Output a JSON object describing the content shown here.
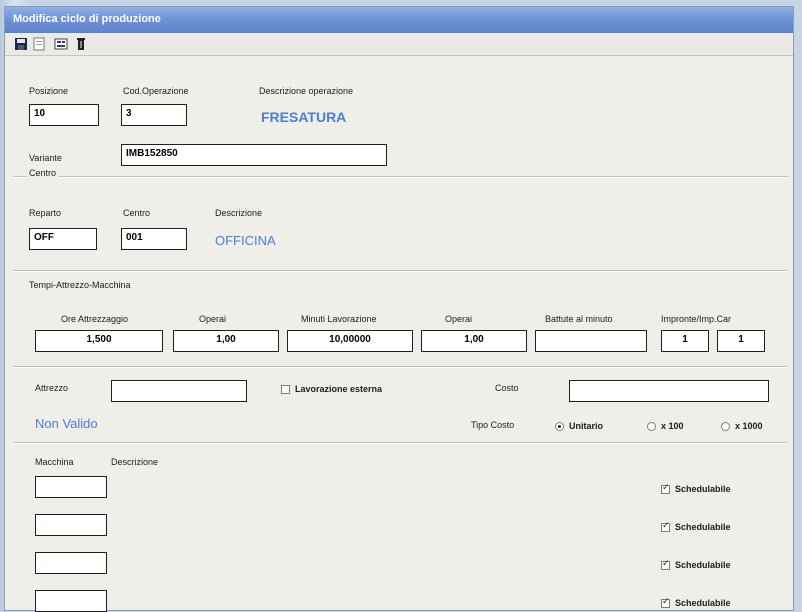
{
  "window": {
    "title": "Modifica ciclo di produzione"
  },
  "toolbar": [
    {
      "name": "save-icon"
    },
    {
      "name": "new-icon"
    },
    {
      "name": "properties-icon"
    },
    {
      "name": "delete-icon"
    }
  ],
  "operazione": {
    "posizione_label": "Posizione",
    "posizione_value": "10",
    "cod_operazione_label": "Cod.Operazione",
    "cod_operazione_value": "3",
    "descrizione_label": "Descrizione operazione",
    "descrizione_value": "FRESATURA",
    "variante_label": "Variante",
    "variante_value": "IMB152850"
  },
  "centro": {
    "group_title": "Centro",
    "reparto_label": "Reparto",
    "reparto_value": "OFF",
    "centro_label": "Centro",
    "centro_value": "001",
    "descrizione_label": "Descrizione",
    "descrizione_value": "OFFICINA"
  },
  "tempi": {
    "group_title": "Tempi-Attrezzo-Macchina",
    "ore_attrezzaggio_label": "Ore Attrezzaggio",
    "ore_attrezzaggio_value": "1,500",
    "operai1_label": "Operai",
    "operai1_value": "1,00",
    "minuti_label": "Minuti Lavorazione",
    "minuti_value": "10,00000",
    "operai2_label": "Operai",
    "operai2_value": "1,00",
    "battute_label": "Battute al minuto",
    "battute_value": "",
    "impronte_label": "Impronte/Imp.Car",
    "impronte_value1": "1",
    "impronte_value2": "1"
  },
  "attrezzo": {
    "attrezzo_label": "Attrezzo",
    "attrezzo_value": "",
    "status": "Non Valido",
    "lavorazione_esterna_label": "Lavorazione esterna",
    "costo_label": "Costo",
    "costo_value": "",
    "tipo_costo_label": "Tipo Costo",
    "tipo_costo_options": [
      "Unitario",
      "x 100",
      "x 1000"
    ],
    "tipo_costo_selected": "Unitario"
  },
  "macchine": {
    "macchina_label": "Macchina",
    "descrizione_label": "Descrizione",
    "rows": [
      {
        "macchina": "",
        "descrizione": "",
        "schedulabile_label": "Schedulabile",
        "schedulabile": true
      },
      {
        "macchina": "",
        "descrizione": "",
        "schedulabile_label": "Schedulabile",
        "schedulabile": true
      },
      {
        "macchina": "",
        "descrizione": "",
        "schedulabile_label": "Schedulabile",
        "schedulabile": true
      },
      {
        "macchina": "",
        "descrizione": "",
        "schedulabile_label": "Schedulabile",
        "schedulabile": true
      }
    ]
  }
}
